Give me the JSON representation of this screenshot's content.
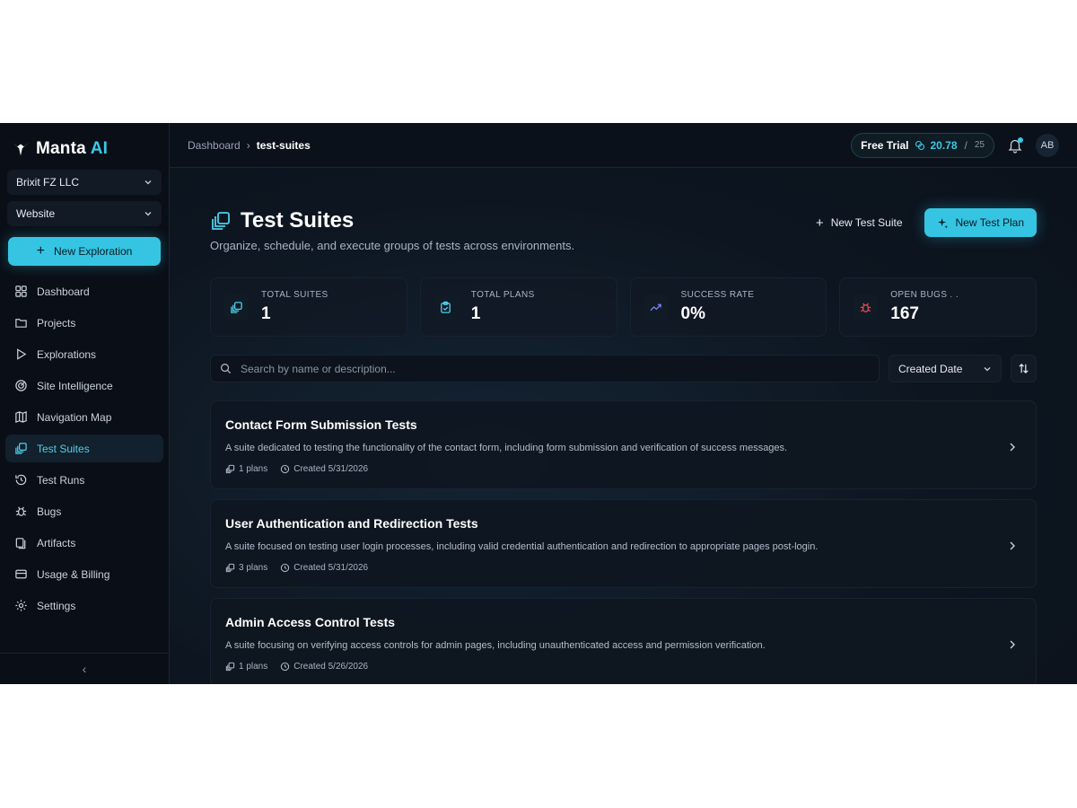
{
  "brand": {
    "name": "Manta",
    "suffix": "AI"
  },
  "sidebar": {
    "org": "Brixit FZ LLC",
    "project": "Website",
    "new_exploration": "New Exploration",
    "items": [
      {
        "label": "Dashboard",
        "icon": "dashboard-icon"
      },
      {
        "label": "Projects",
        "icon": "folder-icon"
      },
      {
        "label": "Explorations",
        "icon": "play-icon"
      },
      {
        "label": "Site Intelligence",
        "icon": "radar-icon"
      },
      {
        "label": "Navigation Map",
        "icon": "map-icon"
      },
      {
        "label": "Test Suites",
        "icon": "test-suites-icon",
        "active": true
      },
      {
        "label": "Test Runs",
        "icon": "history-icon"
      },
      {
        "label": "Bugs",
        "icon": "bug-icon"
      },
      {
        "label": "Artifacts",
        "icon": "artifacts-icon"
      },
      {
        "label": "Usage & Billing",
        "icon": "credit-card-icon"
      },
      {
        "label": "Settings",
        "icon": "gear-icon"
      }
    ],
    "collapse": "‹"
  },
  "topbar": {
    "breadcrumb": {
      "home": "Dashboard",
      "current": "test-suites"
    },
    "trial": {
      "label": "Free Trial",
      "used": "20.78",
      "slash": "/",
      "total": "25"
    },
    "avatar": "AB"
  },
  "page": {
    "title": "Test Suites",
    "subtitle": "Organize, schedule, and execute groups of tests across environments.",
    "new_suite": "New Test Suite",
    "new_plan": "New Test Plan"
  },
  "stats": [
    {
      "label": "TOTAL SUITES",
      "value": "1",
      "icon": "test-suites-icon"
    },
    {
      "label": "TOTAL PLANS",
      "value": "1",
      "icon": "clipboard-check-icon"
    },
    {
      "label": "SUCCESS RATE",
      "value": "0%",
      "icon": "trending-up-icon"
    },
    {
      "label": "OPEN BUGS . .",
      "value": "167",
      "icon": "bug-icon"
    }
  ],
  "filters": {
    "search_placeholder": "Search by name or description...",
    "sort_value": "Created Date"
  },
  "suites": [
    {
      "name": "Contact Form Submission Tests",
      "description": "A suite dedicated to testing the functionality of the contact form, including form submission and verification of success messages.",
      "plans": "1 plans",
      "created": "Created 5/31/2026"
    },
    {
      "name": "User Authentication and Redirection Tests",
      "description": "A suite focused on testing user login processes, including valid credential authentication and redirection to appropriate pages post-login.",
      "plans": "3 plans",
      "created": "Created 5/31/2026"
    },
    {
      "name": "Admin Access Control Tests",
      "description": "A suite focusing on verifying access controls for admin pages, including unauthenticated access and permission verification.",
      "plans": "1 plans",
      "created": "Created 5/26/2026"
    }
  ],
  "colors": {
    "accent": "#35c5e3",
    "background": "#0b111b",
    "sidebar": "#0a0f17",
    "bug_red": "#e5484d",
    "trend_purple": "#7c83f5"
  }
}
